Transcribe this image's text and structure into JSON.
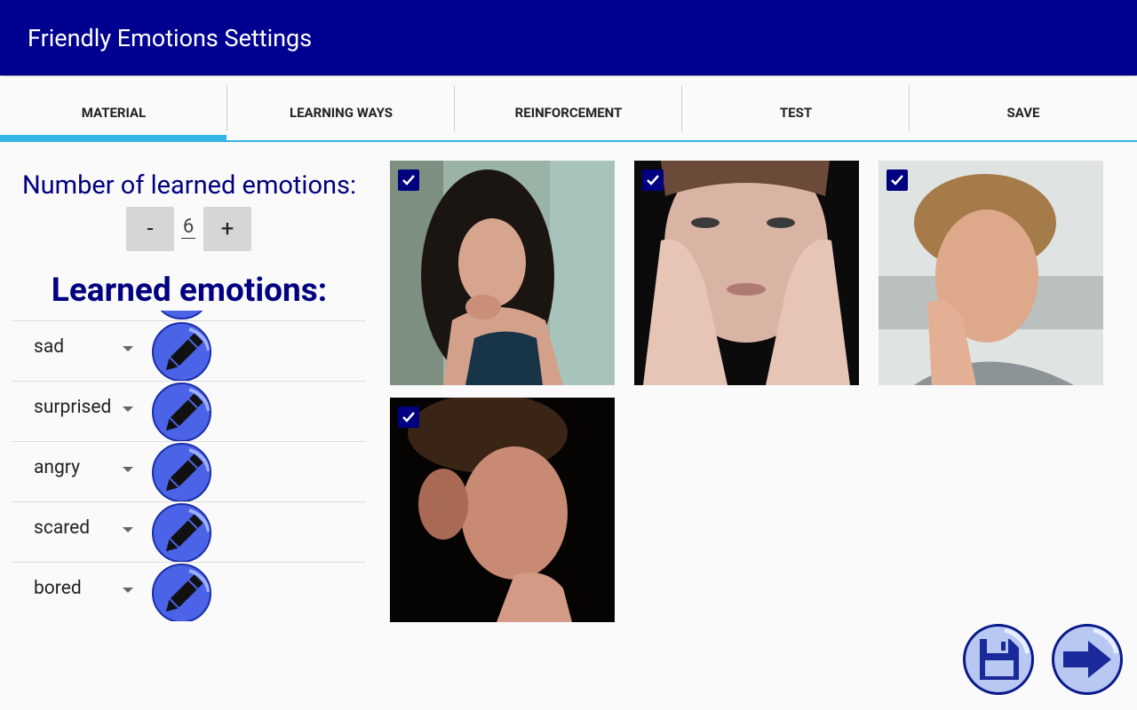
{
  "app": {
    "title": "Friendly Emotions Settings"
  },
  "tabs": [
    {
      "label": "MATERIAL",
      "selected": true
    },
    {
      "label": "LEARNING WAYS",
      "selected": false
    },
    {
      "label": "REINFORCEMENT",
      "selected": false
    },
    {
      "label": "TEST",
      "selected": false
    },
    {
      "label": "SAVE",
      "selected": false
    }
  ],
  "settings": {
    "count_label": "Number of learned emotions:",
    "decrement_label": "-",
    "increment_label": "+",
    "count_value": "6",
    "learned_heading": "Learned emotions:"
  },
  "emotions": [
    {
      "label": "sad"
    },
    {
      "label": "surprised"
    },
    {
      "label": "angry"
    },
    {
      "label": "scared"
    },
    {
      "label": "bored"
    }
  ],
  "photos": [
    {
      "checked": true,
      "subject": "girl-resting-chin-on-hand"
    },
    {
      "checked": true,
      "subject": "face-between-hands"
    },
    {
      "checked": true,
      "subject": "boy-leaning-on-hand"
    },
    {
      "checked": true,
      "subject": "person-head-on-hand-dark"
    }
  ],
  "icons": {
    "edit": "pencil-icon",
    "save": "floppy-disk-icon",
    "next": "forward-arrow-icon",
    "dropdown": "dropdown-arrow-icon",
    "check": "checkmark-icon"
  },
  "colors": {
    "appbar": "#000090",
    "accent": "#33b5e5",
    "heading": "#000080",
    "edit_button": "#4b63e6",
    "fab_fill": "#b8c8f2"
  }
}
